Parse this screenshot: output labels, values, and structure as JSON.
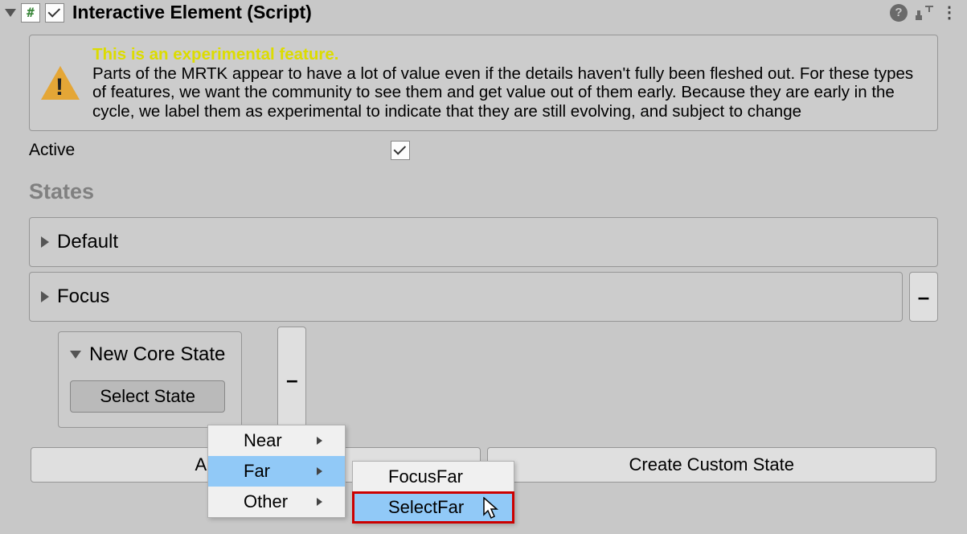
{
  "component": {
    "title": "Interactive Element (Script)",
    "enabled": true,
    "icon_char": "#"
  },
  "warning": {
    "title": "This is an experimental feature.",
    "body": "Parts of the MRTK appear to have a lot of value even if the details haven't fully been fleshed out. For these types of features, we want the community to see them and get value out of them early. Because they are early in the cycle, we label them as experimental to indicate that they are still evolving, and subject to change"
  },
  "fields": {
    "active_label": "Active",
    "active_value": true
  },
  "sections": {
    "states_header": "States"
  },
  "states": [
    {
      "name": "Default",
      "expanded": false,
      "removable": false
    },
    {
      "name": "Focus",
      "expanded": false,
      "removable": true
    },
    {
      "name": "New Core State",
      "expanded": true,
      "removable": true
    }
  ],
  "buttons": {
    "select_state": "Select State",
    "add_core_state": "Add Core State",
    "create_custom_state": "Create Custom State",
    "minus": "–"
  },
  "context_menu": {
    "items": [
      {
        "label": "Near",
        "highlighted": false
      },
      {
        "label": "Far",
        "highlighted": true
      },
      {
        "label": "Other",
        "highlighted": false
      }
    ],
    "submenu": [
      {
        "label": "FocusFar",
        "highlighted": false
      },
      {
        "label": "SelectFar",
        "highlighted": true
      }
    ]
  }
}
